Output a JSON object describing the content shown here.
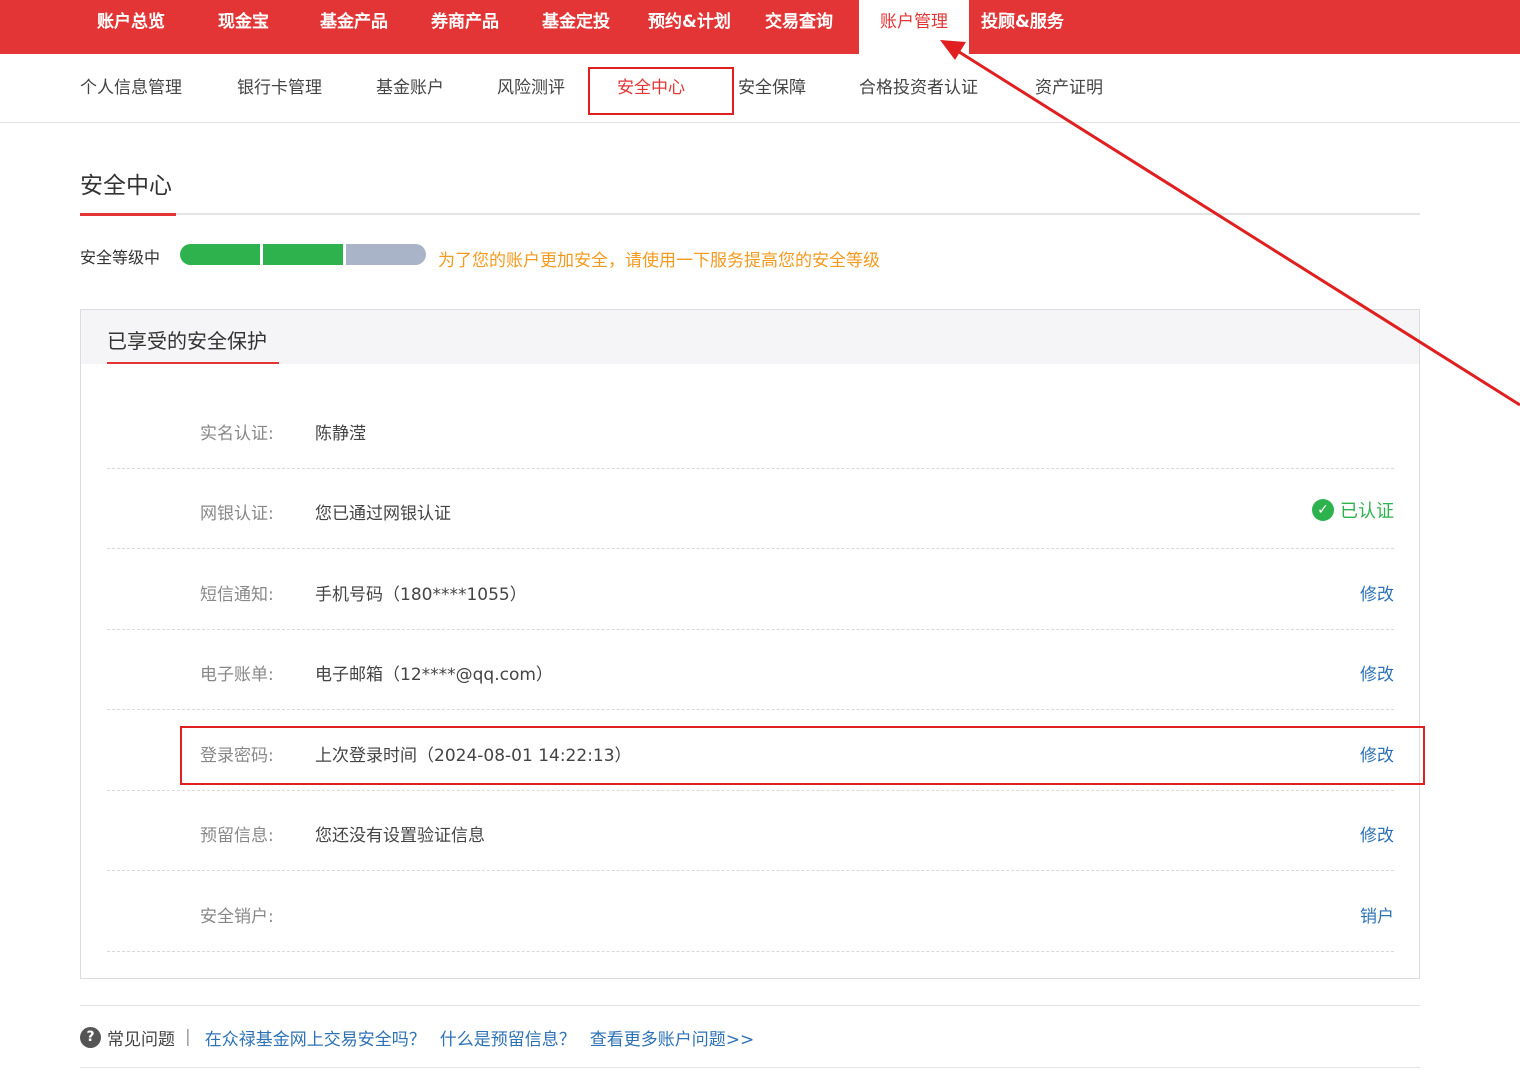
{
  "topnav": {
    "items": [
      "账户总览",
      "现金宝",
      "基金产品",
      "券商产品",
      "基金定投",
      "预约&计划",
      "交易查询",
      "账户管理",
      "投顾&服务"
    ],
    "active_index": 7
  },
  "subnav": {
    "items": [
      "个人信息管理",
      "银行卡管理",
      "基金账户",
      "风险测评",
      "安全中心",
      "安全保障",
      "合格投资者认证",
      "资产证明"
    ],
    "active_index": 4
  },
  "section": {
    "title": "安全中心",
    "level_label": "安全等级中",
    "level_filled": 2,
    "level_total": 3,
    "tip": "为了您的账户更加安全，请使用一下服务提高您的安全等级"
  },
  "protection": {
    "title": "已享受的安全保护",
    "rows": [
      {
        "label": "实名认证:",
        "value": "陈静滢",
        "action": ""
      },
      {
        "label": "网银认证:",
        "value": "您已通过网银认证",
        "action": "",
        "status": "已认证"
      },
      {
        "label": "短信通知:",
        "value": "手机号码（180****1055）",
        "action": "修改"
      },
      {
        "label": "电子账单:",
        "value": "电子邮箱（12****@qq.com）",
        "action": "修改"
      },
      {
        "label": "登录密码:",
        "value": "上次登录时间（2024-08-01 14:22:13）",
        "action": "修改"
      },
      {
        "label": "预留信息:",
        "value": "您还没有设置验证信息",
        "action": "修改"
      },
      {
        "label": "安全销户:",
        "value": "",
        "action": "销户"
      }
    ]
  },
  "faq": {
    "icon": "?",
    "label": "常见问题",
    "separator": "|",
    "links": [
      "在众禄基金网上交易安全吗？",
      "什么是预留信息？",
      "查看更多账户问题>>"
    ]
  },
  "colors": {
    "brand_red": "#e33535",
    "success_green": "#2eb24e",
    "link_blue": "#2e72b6",
    "tip_orange": "#f39a1f",
    "annotation_red": "#e02020"
  }
}
